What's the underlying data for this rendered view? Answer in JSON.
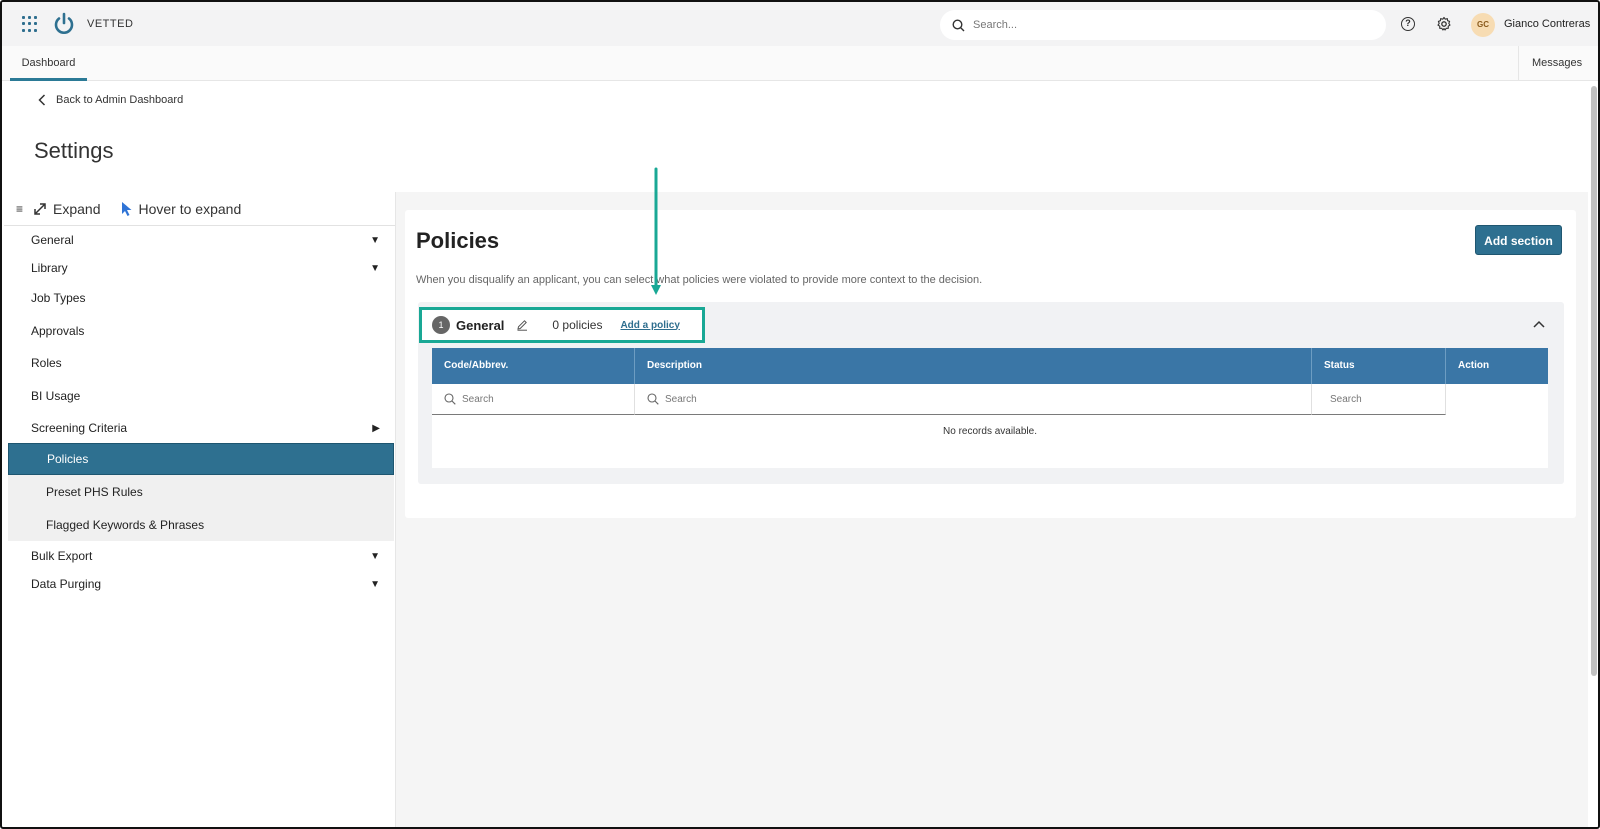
{
  "app": {
    "brand": "VETTED"
  },
  "topbar": {
    "search_placeholder": "Search...",
    "user_initials": "GC",
    "user_name": "Gianco Contreras"
  },
  "tabs": {
    "dashboard": "Dashboard",
    "messages": "Messages"
  },
  "header": {
    "back_label": "Back to Admin Dashboard",
    "title": "Settings"
  },
  "sidebar": {
    "expand_label": "Expand",
    "hover_label": "Hover to expand",
    "items": [
      {
        "label": "General"
      },
      {
        "label": "Library"
      },
      {
        "label": "Job Types"
      },
      {
        "label": "Approvals"
      },
      {
        "label": "Roles"
      },
      {
        "label": "BI Usage"
      },
      {
        "label": "Screening Criteria"
      },
      {
        "label": "Policies"
      },
      {
        "label": "Preset PHS Rules"
      },
      {
        "label": "Flagged Keywords & Phrases"
      },
      {
        "label": "Bulk Export"
      },
      {
        "label": "Data Purging"
      }
    ]
  },
  "policies": {
    "title": "Policies",
    "add_section_label": "Add section",
    "description": "When you disqualify an applicant, you can select what policies were violated to provide more context to the decision.",
    "section": {
      "number": "1",
      "name": "General",
      "count_label": "0 policies",
      "add_policy_label": "Add a policy"
    },
    "table": {
      "columns": [
        "Code/Abbrev.",
        "Description",
        "Status",
        "Action"
      ],
      "filter_placeholder": "Search",
      "empty_text": "No records available."
    }
  },
  "colors": {
    "accent": "#2e7090",
    "table_header": "#3a76a6",
    "highlight": "#19a895"
  }
}
